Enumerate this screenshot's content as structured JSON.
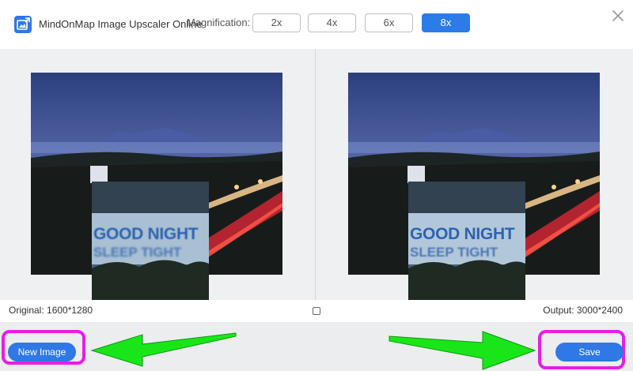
{
  "header": {
    "app_title": "MindOnMap Image Upscaler Online",
    "magnification_label": "Magnification:",
    "magnification_options": [
      "2x",
      "4x",
      "6x",
      "8x"
    ],
    "selected_magnification": "8x"
  },
  "preview": {
    "original_size": "Original: 1600*1280",
    "output_size": "Output: 3000*2400",
    "zoom_text_line1": "GOOD NIGHT",
    "zoom_text_line2": "SLEEP TIGHT"
  },
  "actions": {
    "new_image_label": "New Image",
    "save_label": "Save"
  },
  "colors": {
    "accent": "#2b7be9",
    "highlight": "#e61ee6",
    "arrow": "#19e619"
  }
}
